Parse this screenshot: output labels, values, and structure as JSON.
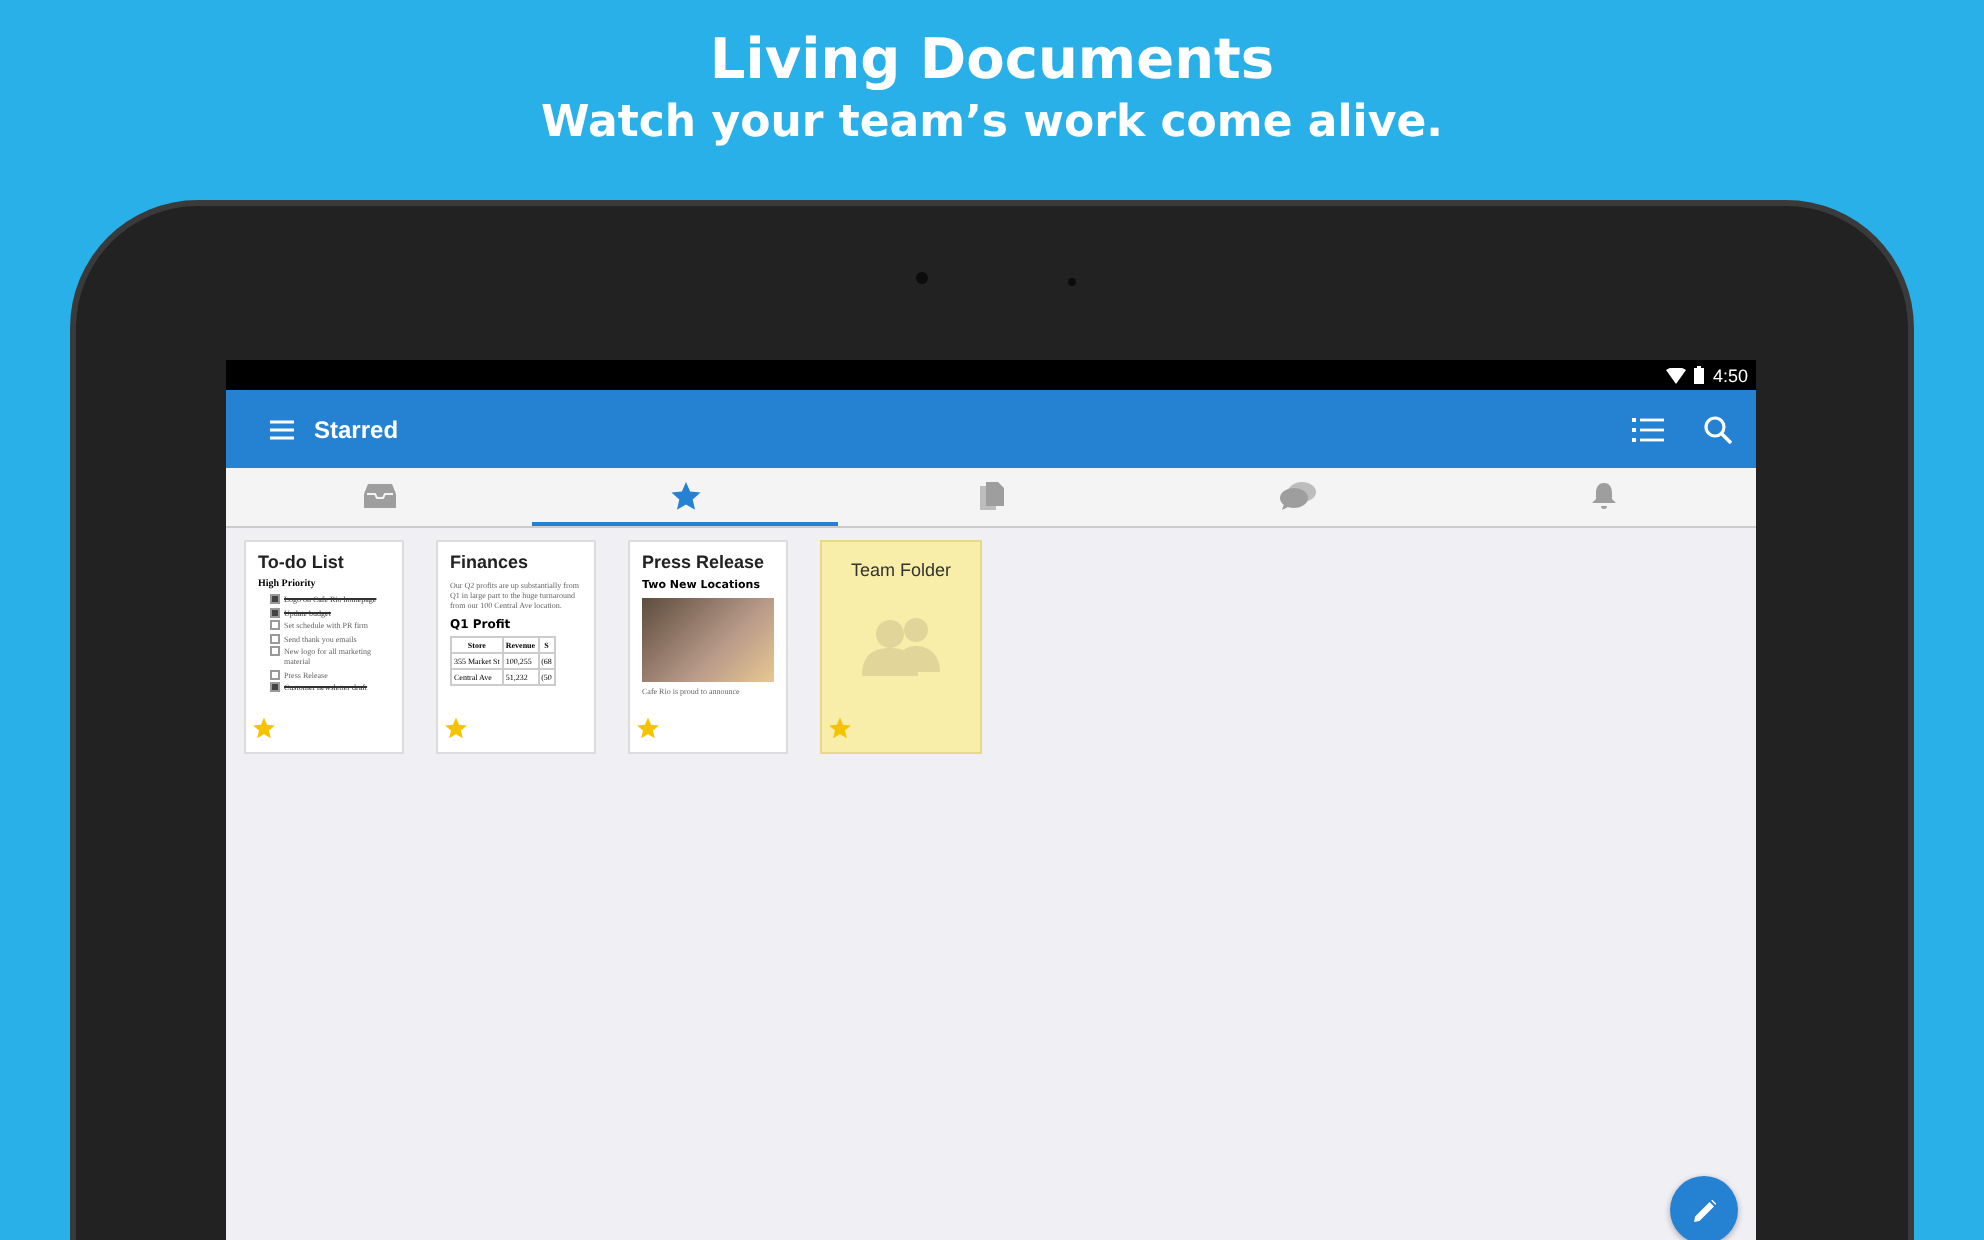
{
  "banner": {
    "title": "Living Documents",
    "subtitle": "Watch your team’s work come alive."
  },
  "status_bar": {
    "time": "4:50"
  },
  "app_bar": {
    "title": "Starred"
  },
  "tabs": [
    {
      "kind": "inbox",
      "selected": false
    },
    {
      "kind": "star",
      "selected": true
    },
    {
      "kind": "documents",
      "selected": false
    },
    {
      "kind": "chat",
      "selected": false
    },
    {
      "kind": "bell",
      "selected": false
    }
  ],
  "cards": [
    {
      "kind": "todo",
      "title": "To-do List",
      "starred": true,
      "heading": "High Priority",
      "items": [
        {
          "text": "Logo on Cafe Rio homepage",
          "checked": true
        },
        {
          "text": "Update budget",
          "checked": true
        },
        {
          "text": "Set schedule with PR firm",
          "checked": false
        },
        {
          "text": "Send thank you emails",
          "checked": false
        },
        {
          "text": "New logo for all marketing material",
          "checked": false
        },
        {
          "text": "Press Release",
          "checked": false
        },
        {
          "text": "Customer newsletter draft",
          "checked": true
        }
      ]
    },
    {
      "kind": "sheet",
      "title": "Finances",
      "starred": true,
      "body": "Our Q2 profits are up substantially from Q1 in large part to the huge turnaround from our 100 Central Ave location.",
      "heading": "Q1 Profit",
      "columns": [
        "Store",
        "Revenue",
        "S"
      ],
      "rows": [
        [
          "355 Market St",
          "100,255",
          "(68"
        ],
        [
          "Central Ave",
          "51,232",
          "(50"
        ]
      ]
    },
    {
      "kind": "article",
      "title": "Press Release",
      "starred": true,
      "heading": "Two New Locations",
      "body": "Cafe Rio is proud to announce"
    },
    {
      "kind": "folder",
      "title": "Team Folder",
      "starred": true
    }
  ]
}
